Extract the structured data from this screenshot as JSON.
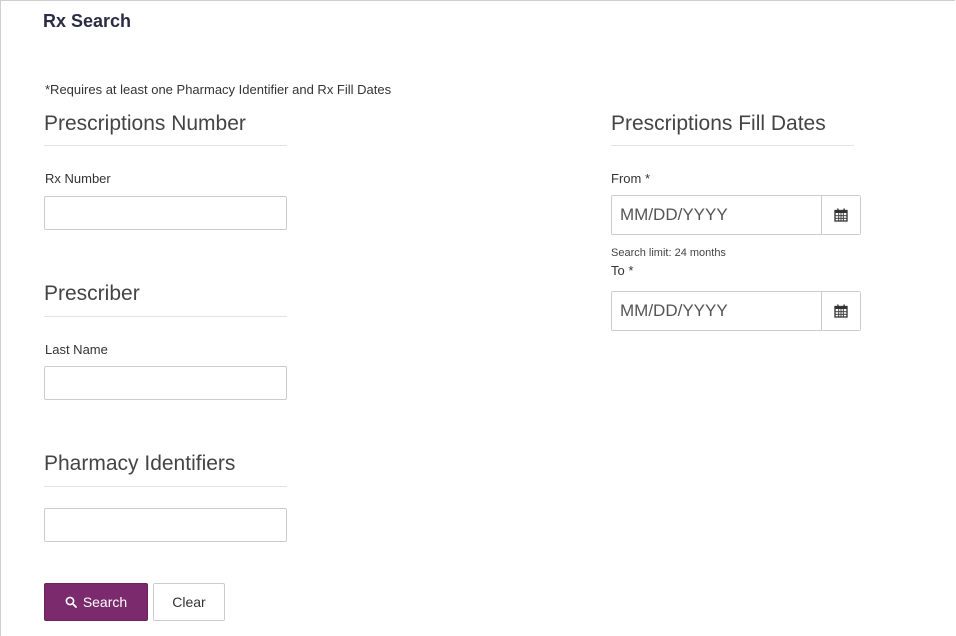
{
  "page": {
    "title": "Rx Search",
    "requirement_note": "*Requires at least one Pharmacy Identifier and Rx Fill Dates"
  },
  "prescriptions_number": {
    "heading": "Prescriptions Number",
    "rx_number_label": "Rx Number",
    "rx_number_value": ""
  },
  "prescriber": {
    "heading": "Prescriber",
    "last_name_label": "Last Name",
    "last_name_value": ""
  },
  "pharmacy_identifiers": {
    "heading": "Pharmacy Identifiers",
    "value": ""
  },
  "fill_dates": {
    "heading": "Prescriptions Fill Dates",
    "from_label": "From *",
    "from_placeholder": "MM/DD/YYYY",
    "search_limit_note": "Search limit: 24 months",
    "to_label": "To *",
    "to_placeholder": "MM/DD/YYYY",
    "calendar_icon": "calendar-icon"
  },
  "actions": {
    "search_label": "Search",
    "search_icon": "search-icon",
    "clear_label": "Clear"
  },
  "colors": {
    "primary_button": "#7a2a6d",
    "title_text": "#2b2b45"
  }
}
